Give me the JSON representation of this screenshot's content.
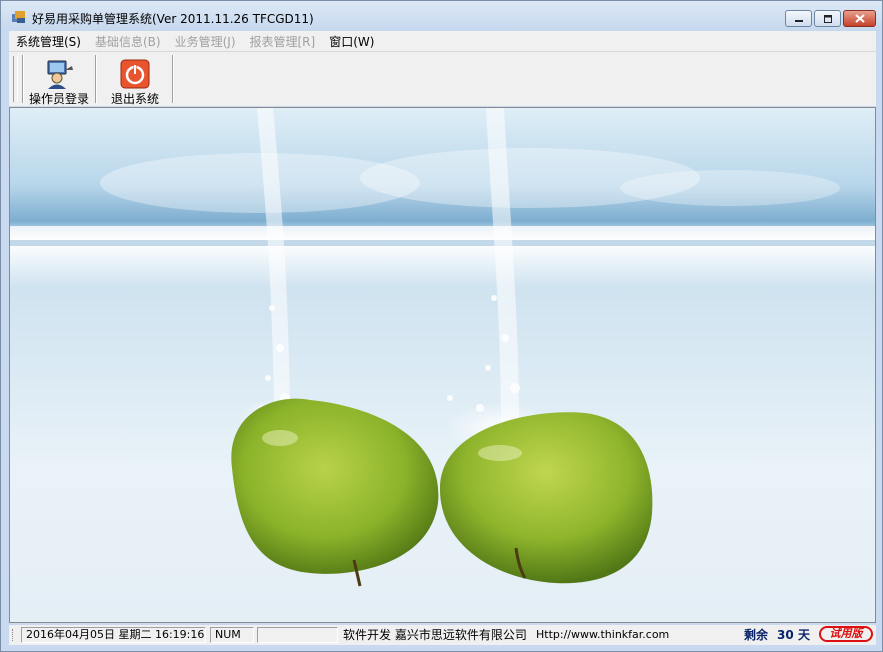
{
  "window": {
    "title": "好易用采购单管理系统(Ver 2011.11.26 TFCGD11)"
  },
  "menu": [
    {
      "label": "系统管理(S)",
      "enabled": true
    },
    {
      "label": "基础信息(B)",
      "enabled": false
    },
    {
      "label": "业务管理(J)",
      "enabled": false
    },
    {
      "label": "报表管理[R]",
      "enabled": false
    },
    {
      "label": "窗口(W)",
      "enabled": true
    }
  ],
  "toolbar": {
    "login_label": "操作员登录",
    "exit_label": "退出系统"
  },
  "statusbar": {
    "datetime": "2016年04月05日 星期二 16:19:16",
    "numlock": "NUM",
    "developer": "软件开发 嘉兴市思远软件有限公司",
    "url": "Http://www.thinkfar.com",
    "remaining_prefix": "剩余",
    "remaining_days": "30",
    "remaining_suffix": "天",
    "trial_stamp": "试用版"
  },
  "colors": {
    "titlebar": "#c6d8ee",
    "close_button": "#c5412b",
    "apple_green": "#8bb32a",
    "trial_red": "#d11111"
  }
}
